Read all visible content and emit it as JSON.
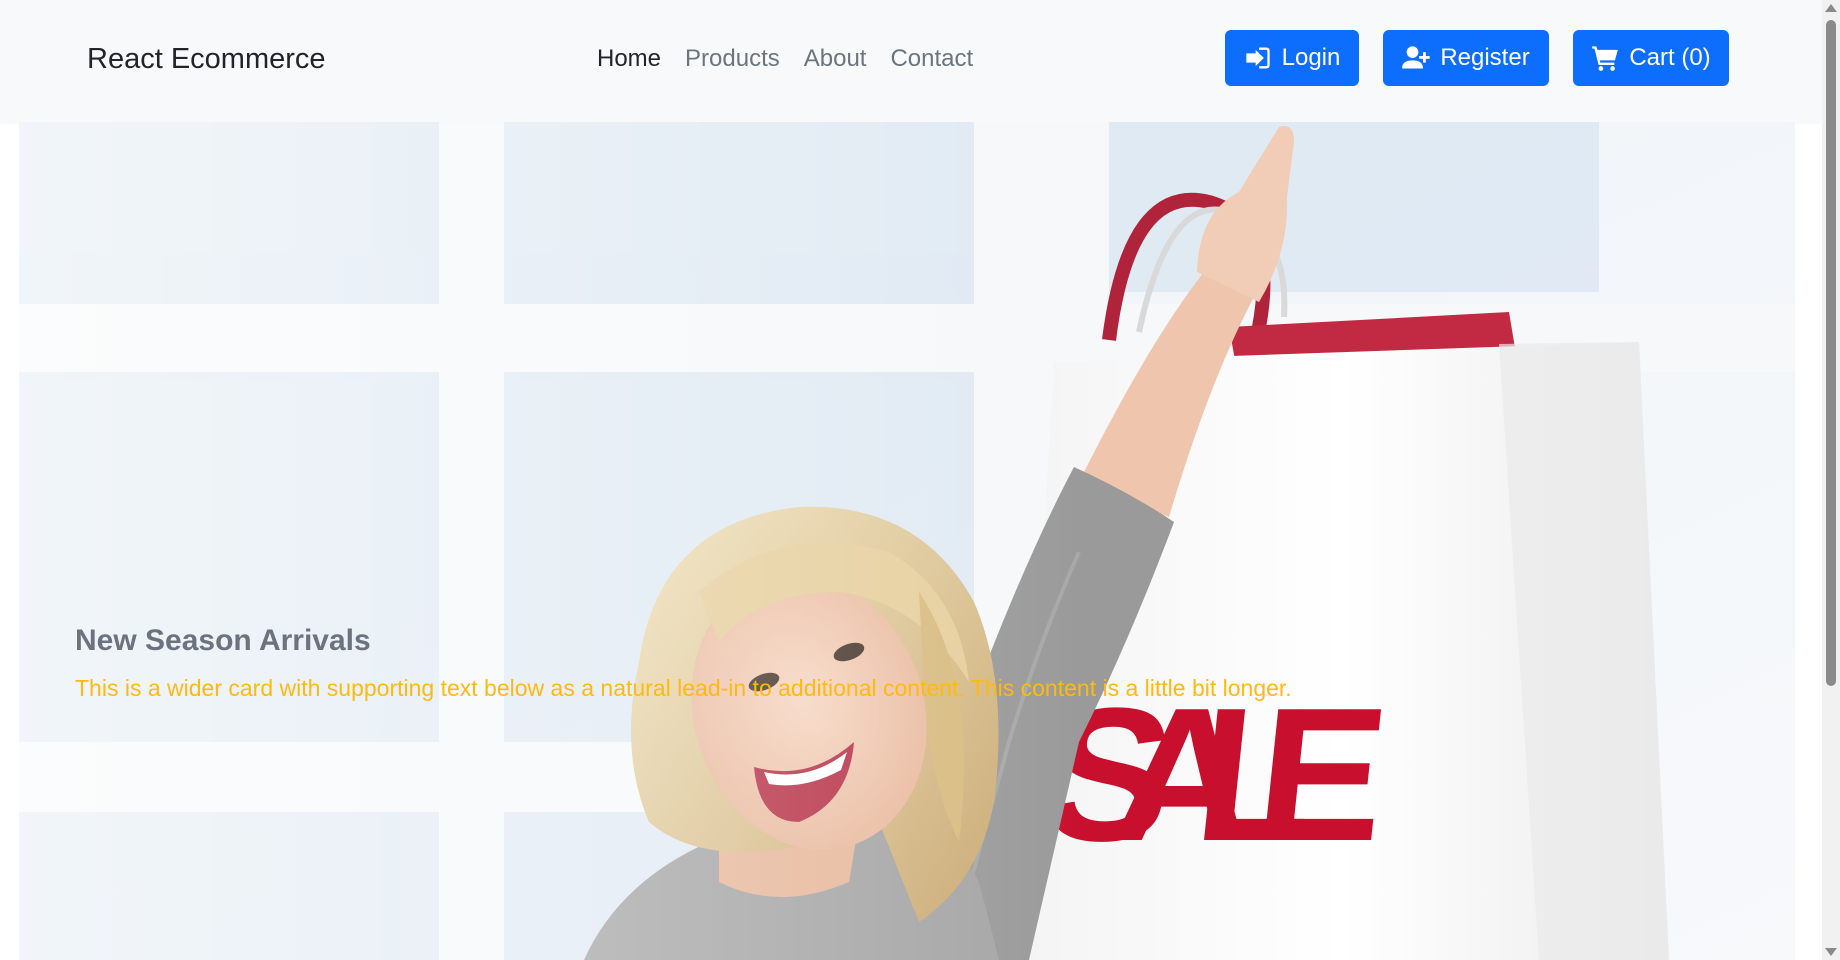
{
  "navbar": {
    "brand": "React Ecommerce",
    "links": [
      {
        "label": "Home",
        "active": true
      },
      {
        "label": "Products",
        "active": false
      },
      {
        "label": "About",
        "active": false
      },
      {
        "label": "Contact",
        "active": false
      }
    ],
    "buttons": {
      "login": {
        "label": "Login",
        "icon": "sign-in-icon"
      },
      "register": {
        "label": "Register",
        "icon": "user-plus-icon"
      },
      "cart": {
        "label": "Cart (0)",
        "icon": "cart-icon"
      }
    }
  },
  "hero": {
    "title": "New Season Arrivals",
    "text": "This is a wider card with supporting text below as a natural lead-in to additional content. This content is a little bit longer.",
    "image_text": "SALE"
  },
  "colors": {
    "primary": "#0d6efd",
    "navbar_bg": "#f8f9fa",
    "hero_title": "#6b7380",
    "hero_text": "#ffb90f",
    "sale_red": "#c8102e"
  }
}
